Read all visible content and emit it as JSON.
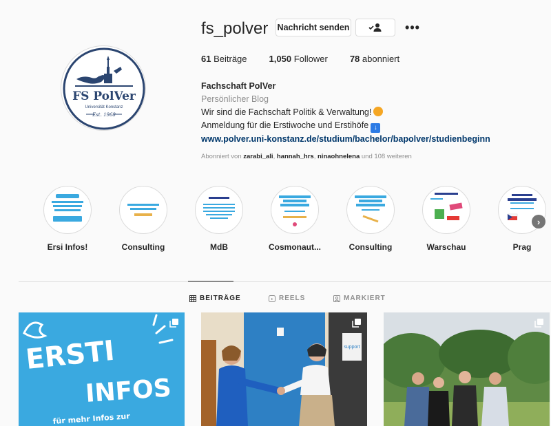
{
  "profile": {
    "username": "fs_polver",
    "message_button": "Nachricht senden",
    "more_label": "•••",
    "avatar": {
      "title": "FS PolVer",
      "subtitle": "Universität Konstanz",
      "est": "Est. 1968"
    }
  },
  "stats": {
    "posts_num": "61",
    "posts_label": "Beiträge",
    "followers_num": "1,050",
    "followers_label": "Follower",
    "following_num": "78",
    "following_label": "abonniert"
  },
  "bio": {
    "name": "Fachschaft PolVer",
    "category": "Persönlicher Blog",
    "line1": "Wir sind die Fachschaft Politik & Verwaltung!",
    "line2": "Anmeldung für die Erstiwoche und Erstihöfe",
    "link": "www.polver.uni-konstanz.de/studium/bachelor/bapolver/studienbeginn",
    "followed_prefix": "Abonniert von",
    "followed_user1": "zarabi_ali",
    "followed_user2": "hannah_hrs",
    "followed_user3": "ninaohnelena",
    "followed_suffix": "und 108 weiteren"
  },
  "highlights": [
    {
      "label": "Ersi Infos!",
      "accent": "#3aa9e0"
    },
    {
      "label": "Consulting",
      "accent": "#e8b14a"
    },
    {
      "label": "MdB",
      "accent": "#3aa9e0"
    },
    {
      "label": "Cosmonaut...",
      "accent": "#3aa9e0"
    },
    {
      "label": "Consulting",
      "accent": "#e8b14a"
    },
    {
      "label": "Warschau",
      "accent": "#e04a7a"
    },
    {
      "label": "Prag",
      "accent": "#2a3f8f"
    }
  ],
  "tabs": {
    "posts": "BEITRÄGE",
    "reels": "REELS",
    "tagged": "MARKIERT"
  },
  "posts": {
    "p1_line1": "ERSTI",
    "p1_line2": "INFOS",
    "p1_small": "für mehr Infos zur",
    "p2_sign": "support"
  },
  "colors": {
    "link": "#00376b",
    "muted": "#8e8e8e",
    "border": "#dbdbdb",
    "avatar_navy": "#2b4570"
  }
}
